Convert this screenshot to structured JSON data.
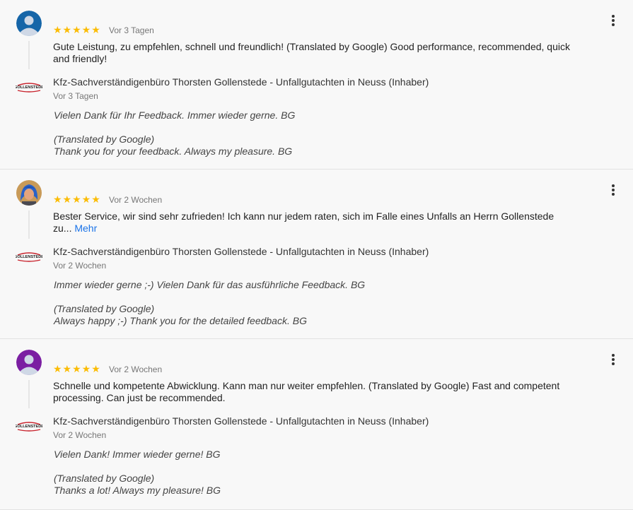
{
  "reviews": [
    {
      "avatar": {
        "type": "default",
        "color": "#1565a8"
      },
      "rating": 5,
      "stars": "★★★★★",
      "date": "Vor 3 Tagen",
      "text": "Gute Leistung, zu empfehlen, schnell und freundlich! (Translated by Google) Good performance, recommended, quick and friendly!",
      "more_label": "",
      "reply": {
        "logo_text": "GOLLENSTEDE",
        "name": "Kfz-Sachverständigenbüro Thorsten Gollenstede - Unfallgutachten in Neuss (Inhaber)",
        "date": "Vor 3 Tagen",
        "line1": "Vielen Dank für Ihr Feedback. Immer wieder gerne. BG",
        "line2": "(Translated by Google)",
        "line3": "Thank you for your feedback. Always my pleasure. BG"
      }
    },
    {
      "avatar": {
        "type": "photo",
        "color": "#c89a58"
      },
      "rating": 5,
      "stars": "★★★★★",
      "date": "Vor 2 Wochen",
      "text": "Bester Service, wir sind sehr zufrieden! Ich kann nur jedem raten, sich im Falle eines Unfalls an Herrn Gollenstede zu...",
      "more_label": "Mehr",
      "reply": {
        "logo_text": "GOLLENSTEDE",
        "name": "Kfz-Sachverständigenbüro Thorsten Gollenstede - Unfallgutachten in Neuss (Inhaber)",
        "date": "Vor 2 Wochen",
        "line1": "Immer wieder gerne ;-) Vielen Dank für das ausführliche Feedback. BG",
        "line2": "(Translated by Google)",
        "line3": "Always happy ;-) Thank you for the detailed feedback. BG"
      }
    },
    {
      "avatar": {
        "type": "default",
        "color": "#7b1fa2"
      },
      "rating": 5,
      "stars": "★★★★★",
      "date": "Vor 2 Wochen",
      "text": "Schnelle und kompetente Abwicklung. Kann man nur weiter empfehlen. (Translated by Google) Fast and competent processing. Can just be recommended.",
      "more_label": "",
      "reply": {
        "logo_text": "GOLLENSTEDE",
        "name": "Kfz-Sachverständigenbüro Thorsten Gollenstede - Unfallgutachten in Neuss (Inhaber)",
        "date": "Vor 2 Wochen",
        "line1": "Vielen Dank! Immer wieder gerne! BG",
        "line2": "(Translated by Google)",
        "line3": "Thanks a lot! Always my pleasure! BG"
      }
    }
  ]
}
